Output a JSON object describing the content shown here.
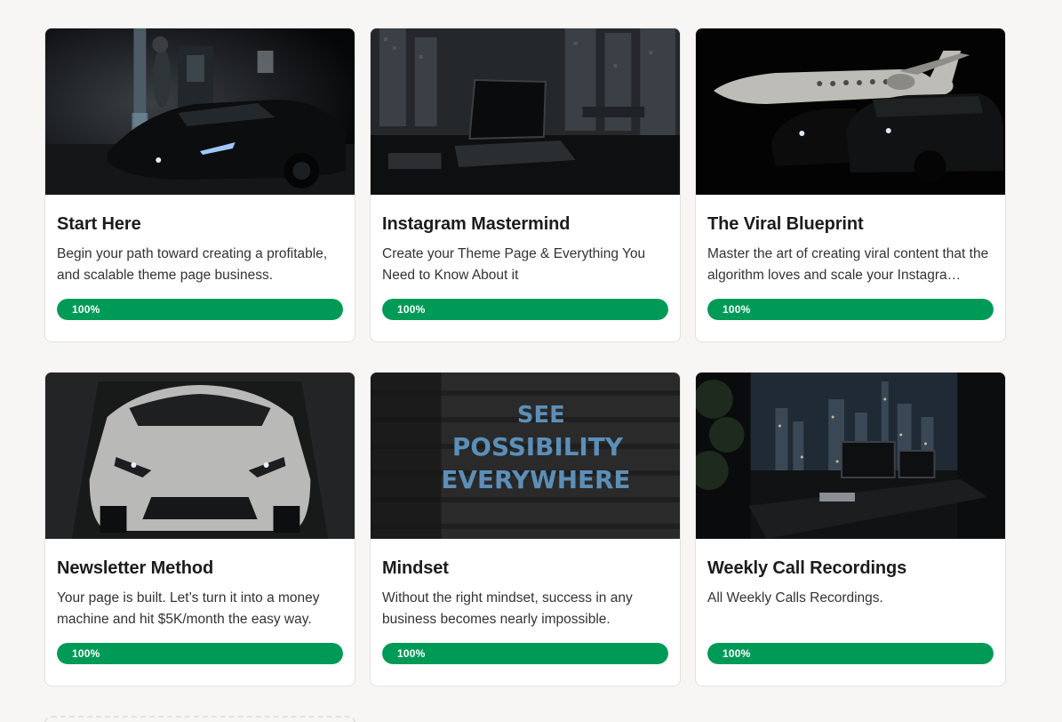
{
  "courses": [
    {
      "title": "Start Here",
      "description": "Begin your path toward creating a profitable, and scalable theme page business.",
      "progress_label": "100%",
      "progress_value": 100,
      "image": "supercar-at-night-gas-station"
    },
    {
      "title": "Instagram Mastermind",
      "description": "Create your Theme Page & Everything You Need to Know About it",
      "progress_label": "100%",
      "progress_value": 100,
      "image": "laptop-on-desk-city-view"
    },
    {
      "title": "The Viral Blueprint",
      "description": "Master the art of creating viral content that the algorithm loves and scale your Instagra…",
      "progress_label": "100%",
      "progress_value": 100,
      "image": "private-jet-and-suvs"
    },
    {
      "title": "Newsletter Method",
      "description": "Your page is built. Let’s turn it into a money machine and hit $5K/month the easy way.",
      "progress_label": "100%",
      "progress_value": 100,
      "image": "white-supercar-dark-garage"
    },
    {
      "title": "Mindset",
      "description": "Without the right mindset, success in any business becomes nearly impossible.",
      "progress_label": "100%",
      "progress_value": 100,
      "image": "see-possibility-everywhere-sign",
      "image_text": [
        "SEE",
        "POSSIBILITY",
        "EVERYWHERE"
      ]
    },
    {
      "title": "Weekly Call Recordings",
      "description": "All Weekly Calls Recordings.",
      "progress_label": "100%",
      "progress_value": 100,
      "image": "office-desk-skyline-night"
    }
  ],
  "colors": {
    "page_background": "#f7f6f4",
    "progress_fill": "#009a57",
    "card_border": "#e3e2df"
  }
}
